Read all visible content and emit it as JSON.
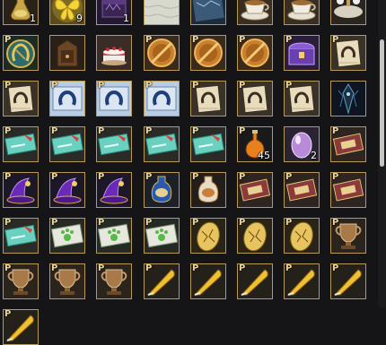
{
  "inventory": {
    "slots": [
      {
        "icon": "elixir-flask-icon",
        "p": false,
        "qty": "1"
      },
      {
        "icon": "yellow-butterfly-icon",
        "p": false,
        "qty": "9"
      },
      {
        "icon": "dark-purple-chest-icon",
        "p": false,
        "qty": "1"
      },
      {
        "icon": "white-cloth-icon",
        "p": false,
        "qty": ""
      },
      {
        "icon": "blue-map-icon",
        "p": false,
        "qty": ""
      },
      {
        "icon": "teacup-icon",
        "p": false,
        "qty": ""
      },
      {
        "icon": "teacup-icon",
        "p": false,
        "qty": ""
      },
      {
        "icon": "table-set-icon",
        "p": false,
        "qty": ""
      },
      {
        "icon": "horseshoe-emblem-icon",
        "p": true,
        "qty": ""
      },
      {
        "icon": "wooden-cabinet-icon",
        "p": false,
        "qty": ""
      },
      {
        "icon": "birthday-cake-icon",
        "p": false,
        "qty": ""
      },
      {
        "icon": "crossed-coin-icon",
        "p": true,
        "qty": ""
      },
      {
        "icon": "crossed-coin-icon",
        "p": true,
        "qty": ""
      },
      {
        "icon": "crossed-coin-icon",
        "p": true,
        "qty": ""
      },
      {
        "icon": "purple-treasure-chest-icon",
        "p": true,
        "qty": ""
      },
      {
        "icon": "horseshoe-scroll-icon",
        "p": true,
        "qty": ""
      },
      {
        "icon": "horseshoe-scroll-icon",
        "p": true,
        "qty": ""
      },
      {
        "icon": "blue-horseshoe-flag-icon",
        "p": true,
        "qty": ""
      },
      {
        "icon": "blue-horseshoe-flag-icon",
        "p": true,
        "qty": ""
      },
      {
        "icon": "blue-horseshoe-flag-icon",
        "p": true,
        "qty": ""
      },
      {
        "icon": "horseshoe-scroll-icon",
        "p": true,
        "qty": ""
      },
      {
        "icon": "horseshoe-scroll-icon",
        "p": true,
        "qty": ""
      },
      {
        "icon": "horseshoe-scroll-icon",
        "p": true,
        "qty": ""
      },
      {
        "icon": "dark-crystal-icon",
        "p": false,
        "qty": ""
      },
      {
        "icon": "teal-ticket-icon",
        "p": true,
        "qty": ""
      },
      {
        "icon": "teal-ticket-icon",
        "p": true,
        "qty": ""
      },
      {
        "icon": "teal-ticket-icon",
        "p": true,
        "qty": ""
      },
      {
        "icon": "teal-ticket-icon",
        "p": true,
        "qty": ""
      },
      {
        "icon": "teal-ticket-icon",
        "p": true,
        "qty": ""
      },
      {
        "icon": "orange-potion-icon",
        "p": true,
        "qty": "45"
      },
      {
        "icon": "purple-egg-icon",
        "p": false,
        "qty": "2"
      },
      {
        "icon": "coupon-card-icon",
        "p": true,
        "qty": ""
      },
      {
        "icon": "purple-wizard-hat-icon",
        "p": true,
        "qty": ""
      },
      {
        "icon": "purple-wizard-hat-icon",
        "p": true,
        "qty": ""
      },
      {
        "icon": "purple-wizard-hat-icon",
        "p": true,
        "qty": ""
      },
      {
        "icon": "blue-vase-icon",
        "p": true,
        "qty": ""
      },
      {
        "icon": "white-vase-icon",
        "p": true,
        "qty": ""
      },
      {
        "icon": "coupon-card-icon",
        "p": true,
        "qty": ""
      },
      {
        "icon": "coupon-card-icon",
        "p": true,
        "qty": ""
      },
      {
        "icon": "coupon-card-icon",
        "p": true,
        "qty": ""
      },
      {
        "icon": "teal-ticket-icon",
        "p": true,
        "qty": ""
      },
      {
        "icon": "green-paw-coupon-icon",
        "p": true,
        "qty": ""
      },
      {
        "icon": "green-paw-coupon-icon",
        "p": true,
        "qty": ""
      },
      {
        "icon": "green-paw-coupon-icon",
        "p": true,
        "qty": ""
      },
      {
        "icon": "golden-egg-icon",
        "p": true,
        "qty": ""
      },
      {
        "icon": "golden-egg-icon",
        "p": true,
        "qty": ""
      },
      {
        "icon": "golden-egg-icon",
        "p": true,
        "qty": ""
      },
      {
        "icon": "bronze-trophy-icon",
        "p": true,
        "qty": ""
      },
      {
        "icon": "bronze-trophy-icon",
        "p": true,
        "qty": ""
      },
      {
        "icon": "bronze-trophy-icon",
        "p": true,
        "qty": ""
      },
      {
        "icon": "bronze-trophy-icon",
        "p": true,
        "qty": ""
      },
      {
        "icon": "golden-quill-icon",
        "p": true,
        "qty": ""
      },
      {
        "icon": "golden-quill-icon",
        "p": true,
        "qty": ""
      },
      {
        "icon": "golden-quill-icon",
        "p": true,
        "qty": ""
      },
      {
        "icon": "golden-quill-icon",
        "p": true,
        "qty": ""
      },
      {
        "icon": "golden-quill-icon",
        "p": true,
        "qty": ""
      },
      {
        "icon": "golden-quill-icon",
        "p": true,
        "qty": ""
      }
    ],
    "p_label": "P"
  },
  "colors": {
    "slot_border": "#b89a58",
    "background": "#151517"
  }
}
